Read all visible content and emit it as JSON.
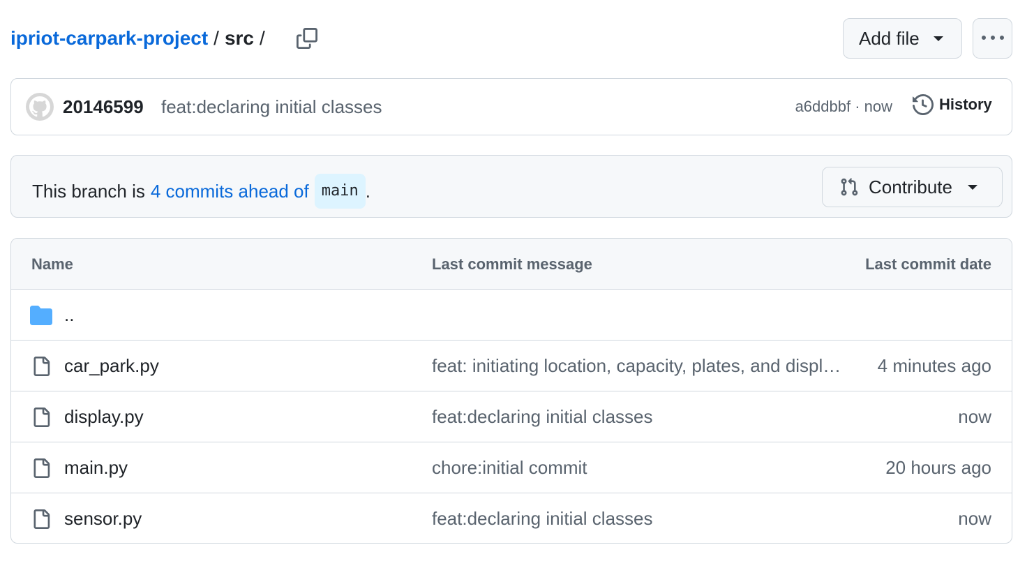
{
  "header": {
    "repo_name": "ipriot-carpark-project",
    "separator": "/",
    "directory": "src",
    "trailing_separator": "/",
    "copy_icon": "copy-icon",
    "add_file_label": "Add file",
    "more_icon": "kebab-horizontal-icon"
  },
  "commit": {
    "author": "20146599",
    "message": "feat:declaring initial classes",
    "meta": "a6ddbbf · now",
    "history_label": "History",
    "history_icon": "history-icon"
  },
  "branch": {
    "prefix": "This branch is",
    "link_text": "4 commits ahead of",
    "base_branch": "main",
    "suffix": ".",
    "contribute_label": "Contribute",
    "contribute_icon": "git-pull-request-icon"
  },
  "table": {
    "columns": {
      "name": "Name",
      "message": "Last commit message",
      "date": "Last commit date"
    },
    "parent_row": {
      "name": "..",
      "icon": "folder-icon"
    },
    "files": [
      {
        "name": "car_park.py",
        "message": "feat: initiating location, capacity, plates, and displays",
        "date": "4 minutes ago",
        "icon": "file-icon"
      },
      {
        "name": "display.py",
        "message": "feat:declaring initial classes",
        "date": "now",
        "icon": "file-icon"
      },
      {
        "name": "main.py",
        "message": "chore:initial commit",
        "date": "20 hours ago",
        "icon": "file-icon"
      },
      {
        "name": "sensor.py",
        "message": "feat:declaring initial classes",
        "date": "now",
        "icon": "file-icon"
      }
    ]
  },
  "colors": {
    "link": "#0969da",
    "muted_text": "#59636e",
    "border": "#d0d7de",
    "subtle_bg": "#f6f8fa",
    "folder": "#54aeff",
    "code_bg": "#ddf4ff"
  }
}
